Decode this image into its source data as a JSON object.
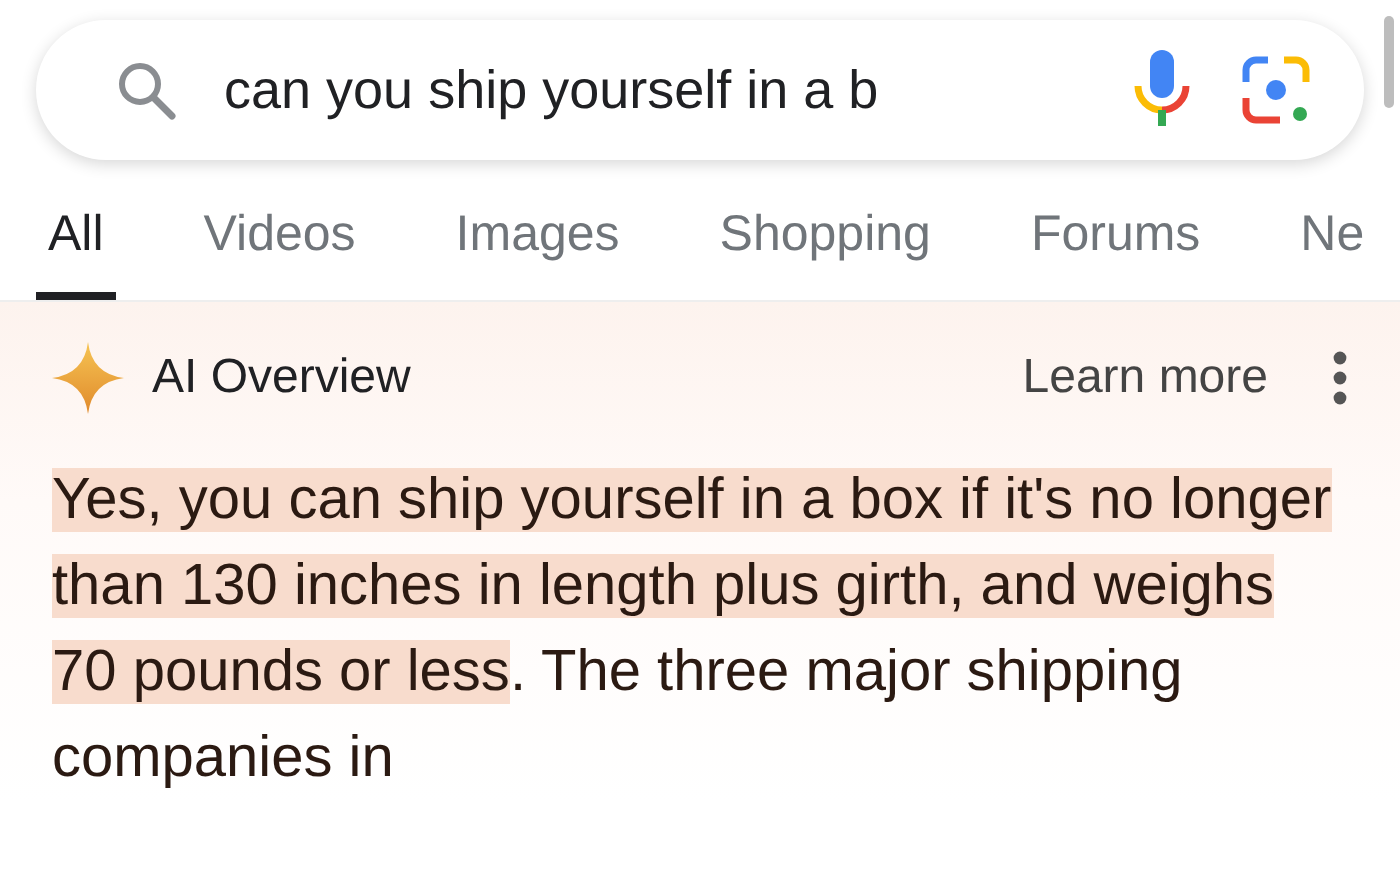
{
  "search": {
    "value": "can you ship yourself in a b"
  },
  "tabs": [
    {
      "label": "All",
      "selected": true
    },
    {
      "label": "Videos",
      "selected": false
    },
    {
      "label": "Images",
      "selected": false
    },
    {
      "label": "Shopping",
      "selected": false
    },
    {
      "label": "Forums",
      "selected": false
    },
    {
      "label": "Ne",
      "selected": false
    }
  ],
  "ai_overview": {
    "title": "AI Overview",
    "learn_more": "Learn more",
    "answer": {
      "highlighted": "Yes, you can ship yourself in a box if it's no longer than 130 inches in length plus girth, and weighs 70 pounds or less",
      "rest": ". The three major shipping companies in"
    }
  }
}
